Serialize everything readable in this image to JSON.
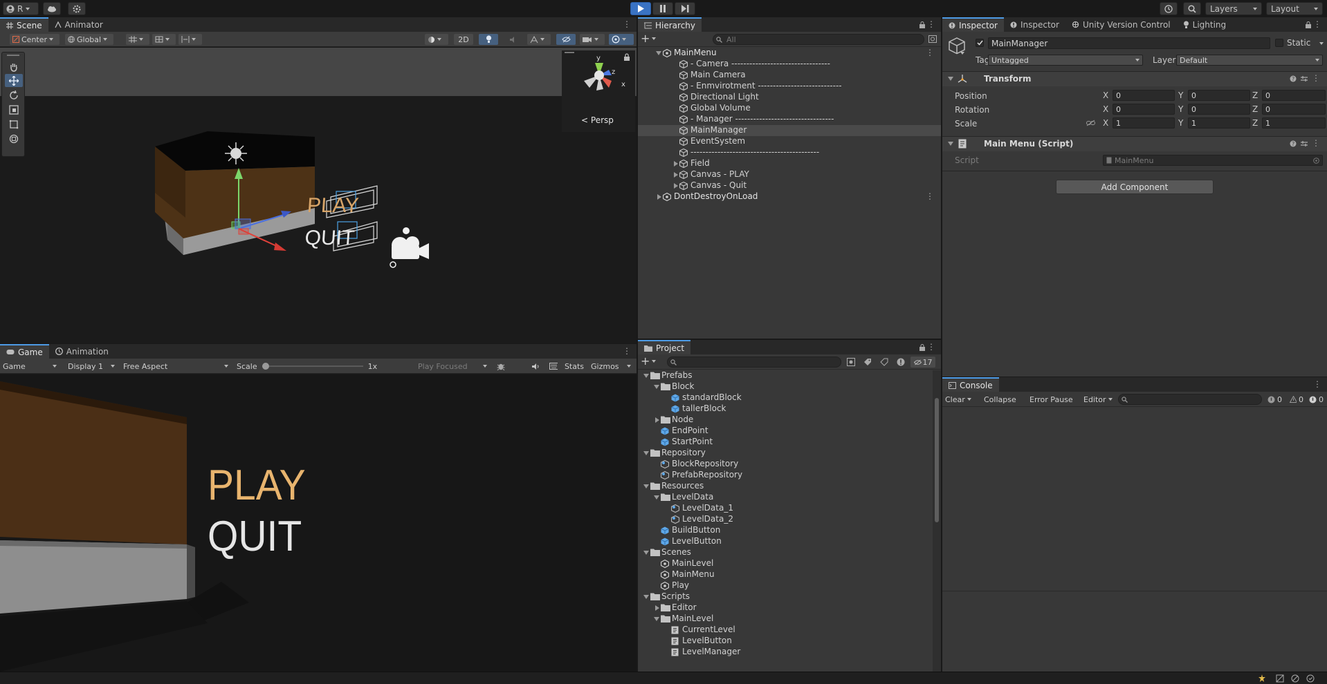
{
  "topbar": {
    "account": "R",
    "layers": "Layers",
    "layout": "Layout"
  },
  "scene": {
    "tabs": [
      "Scene",
      "Animator"
    ],
    "pivot": "Center",
    "space": "Global",
    "mode2d": "2D",
    "persp": "Persp",
    "gizmo_axes": [
      "y",
      "z",
      "x"
    ],
    "canvas_text": [
      "PLAY",
      "QUIT"
    ]
  },
  "game": {
    "tabs": [
      "Game",
      "Animation"
    ],
    "view": "Game",
    "display": "Display 1",
    "aspect": "Free Aspect",
    "scale_label": "Scale",
    "scale_value": "1x",
    "play_focused": "Play Focused",
    "stats": "Stats",
    "gizmos": "Gizmos",
    "play_text": "PLAY",
    "quit_text": "QUIT"
  },
  "hierarchy": {
    "title": "Hierarchy",
    "search_placeholder": "All",
    "items": [
      {
        "label": "MainMenu",
        "depth": 0,
        "kind": "scene",
        "expanded": true
      },
      {
        "label": "- Camera ---------------------------------",
        "depth": 1,
        "kind": "object"
      },
      {
        "label": "Main Camera",
        "depth": 1,
        "kind": "object"
      },
      {
        "label": "- Enmvirotment ----------------------------",
        "depth": 1,
        "kind": "object"
      },
      {
        "label": "Directional Light",
        "depth": 1,
        "kind": "object"
      },
      {
        "label": "Global Volume",
        "depth": 1,
        "kind": "object"
      },
      {
        "label": "- Manager ---------------------------------",
        "depth": 1,
        "kind": "object"
      },
      {
        "label": "MainManager",
        "depth": 1,
        "kind": "object",
        "selected": true
      },
      {
        "label": "EventSystem",
        "depth": 1,
        "kind": "object"
      },
      {
        "label": "-------------------------------------------",
        "depth": 1,
        "kind": "object"
      },
      {
        "label": "Field",
        "depth": 1,
        "kind": "object",
        "collapsed": true
      },
      {
        "label": "Canvas - PLAY",
        "depth": 1,
        "kind": "object",
        "collapsed": true
      },
      {
        "label": "Canvas - Quit",
        "depth": 1,
        "kind": "object",
        "collapsed": true
      },
      {
        "label": "DontDestroyOnLoad",
        "depth": 0,
        "kind": "scene",
        "collapsed": true
      }
    ]
  },
  "project": {
    "title": "Project",
    "hidden_count": "17",
    "items": [
      {
        "label": "Prefabs",
        "depth": 0,
        "kind": "folder",
        "expanded": true
      },
      {
        "label": "Block",
        "depth": 1,
        "kind": "folder",
        "expanded": true
      },
      {
        "label": "standardBlock",
        "depth": 2,
        "kind": "prefab"
      },
      {
        "label": "tallerBlock",
        "depth": 2,
        "kind": "prefab"
      },
      {
        "label": "Node",
        "depth": 1,
        "kind": "folder",
        "collapsed": true
      },
      {
        "label": "EndPoint",
        "depth": 1,
        "kind": "prefab"
      },
      {
        "label": "StartPoint",
        "depth": 1,
        "kind": "prefab"
      },
      {
        "label": "Repository",
        "depth": 0,
        "kind": "folder",
        "expanded": true
      },
      {
        "label": "BlockRepository",
        "depth": 1,
        "kind": "asset"
      },
      {
        "label": "PrefabRepository",
        "depth": 1,
        "kind": "asset"
      },
      {
        "label": "Resources",
        "depth": 0,
        "kind": "folder",
        "expanded": true
      },
      {
        "label": "LevelData",
        "depth": 1,
        "kind": "folder",
        "expanded": true
      },
      {
        "label": "LevelData_1",
        "depth": 2,
        "kind": "asset"
      },
      {
        "label": "LevelData_2",
        "depth": 2,
        "kind": "asset"
      },
      {
        "label": "BuildButton",
        "depth": 1,
        "kind": "prefab"
      },
      {
        "label": "LevelButton",
        "depth": 1,
        "kind": "prefab"
      },
      {
        "label": "Scenes",
        "depth": 0,
        "kind": "folder",
        "expanded": true
      },
      {
        "label": "MainLevel",
        "depth": 1,
        "kind": "scene"
      },
      {
        "label": "MainMenu",
        "depth": 1,
        "kind": "scene"
      },
      {
        "label": "Play",
        "depth": 1,
        "kind": "scene"
      },
      {
        "label": "Scripts",
        "depth": 0,
        "kind": "folder",
        "expanded": true
      },
      {
        "label": "Editor",
        "depth": 1,
        "kind": "folder",
        "collapsed": true
      },
      {
        "label": "MainLevel",
        "depth": 1,
        "kind": "folder",
        "expanded": true
      },
      {
        "label": "CurrentLevel",
        "depth": 2,
        "kind": "script"
      },
      {
        "label": "LevelButton",
        "depth": 2,
        "kind": "script"
      },
      {
        "label": "LevelManager",
        "depth": 2,
        "kind": "script"
      }
    ]
  },
  "inspector": {
    "tabs": [
      "Inspector",
      "Inspector",
      "Unity Version Control",
      "Lighting"
    ],
    "object_name": "MainManager",
    "static_label": "Static",
    "tag_label": "Tag",
    "tag_value": "Untagged",
    "layer_label": "Layer",
    "layer_value": "Default",
    "transform": {
      "title": "Transform",
      "position_label": "Position",
      "rotation_label": "Rotation",
      "scale_label": "Scale",
      "axes": [
        "X",
        "Y",
        "Z"
      ],
      "position": [
        "0",
        "0",
        "0"
      ],
      "rotation": [
        "0",
        "0",
        "0"
      ],
      "scale": [
        "1",
        "1",
        "1"
      ]
    },
    "script": {
      "title": "Main Menu (Script)",
      "script_label": "Script",
      "script_value": "MainMenu"
    },
    "add_component": "Add Component"
  },
  "console": {
    "title": "Console",
    "clear": "Clear",
    "collapse": "Collapse",
    "error_pause": "Error Pause",
    "editor": "Editor",
    "log_count": "0",
    "warn_count": "0",
    "error_count": "0"
  },
  "colors": {
    "accent": "#4d9be6",
    "panel": "#383838",
    "selected_row": "#4a4a4a",
    "play_text": "#e8b46e",
    "quit_text": "#e6e6e6"
  }
}
